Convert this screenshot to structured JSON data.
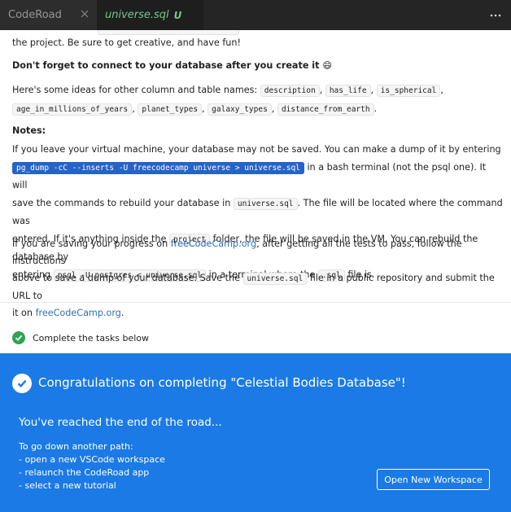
{
  "tabs": [
    {
      "label": "CodeRoad"
    },
    {
      "label": "universe.sql",
      "badge": "U"
    }
  ],
  "content": {
    "frag_line_end": "the project. Be sure to get creative, and have fun!",
    "reminder": "Don't forget to connect to your database after you create it",
    "reminder_emoji": "😄",
    "ideas_intro": "Here's some ideas for other column and table names:",
    "ideas": [
      "description",
      "has_life",
      "is_spherical",
      "age_in_millions_of_years",
      "planet_types",
      "galaxy_types",
      "distance_from_earth"
    ],
    "notes_heading": "Notes:",
    "notes_line1": "If you leave your virtual machine, your database may not be saved. You can make a dump of it by entering",
    "dump_cmd": "pg_dump -cC --inserts -U freecodecamp universe > universe.sql",
    "notes_line2_after": "in a bash terminal (not the psql one). It will",
    "notes_line3_a": "save the commands to rebuild your database in",
    "file_code": "universe.sql",
    "notes_line3_b": ". The file will be located where the command was",
    "notes_line4_a": "entered. If it's anything inside the",
    "project_code": "project",
    "notes_line4_b": "folder, the file will be saved in the VM. You can rebuild the database by",
    "notes_line5_a": "entering",
    "restore_cmd": "psql -U postgres < universe.sql",
    "notes_line5_b": "in a terminal where the",
    "sql_code": ".sql",
    "notes_line5_c": "file is.",
    "save_line1_a": "If you are saving your progress on",
    "link": "freeCodeCamp.org",
    "save_line1_b": ", after getting all the tests to pass, follow the instructions",
    "save_line2_a": "above to save a dump of your database. Save the",
    "save_line2_b": "file in a public repository and submit the URL to",
    "save_line3_a": "it on",
    "save_line3_b": "."
  },
  "task": {
    "label": "Complete the tasks below"
  },
  "banner": {
    "title": "Congratulations on completing \"Celestial Bodies Database\"!",
    "subtitle": "You've reached the end of the road...",
    "lines": [
      "To go down another path:",
      "- open a new VSCode workspace",
      "- relaunch the CodeRoad app",
      "- select a new tutorial"
    ],
    "button": "Open New Workspace"
  },
  "colors": {
    "accent": "#1b7ae6",
    "tab_modified": "#73c991",
    "success": "#2ea44f",
    "link": "#2f6fb7"
  }
}
